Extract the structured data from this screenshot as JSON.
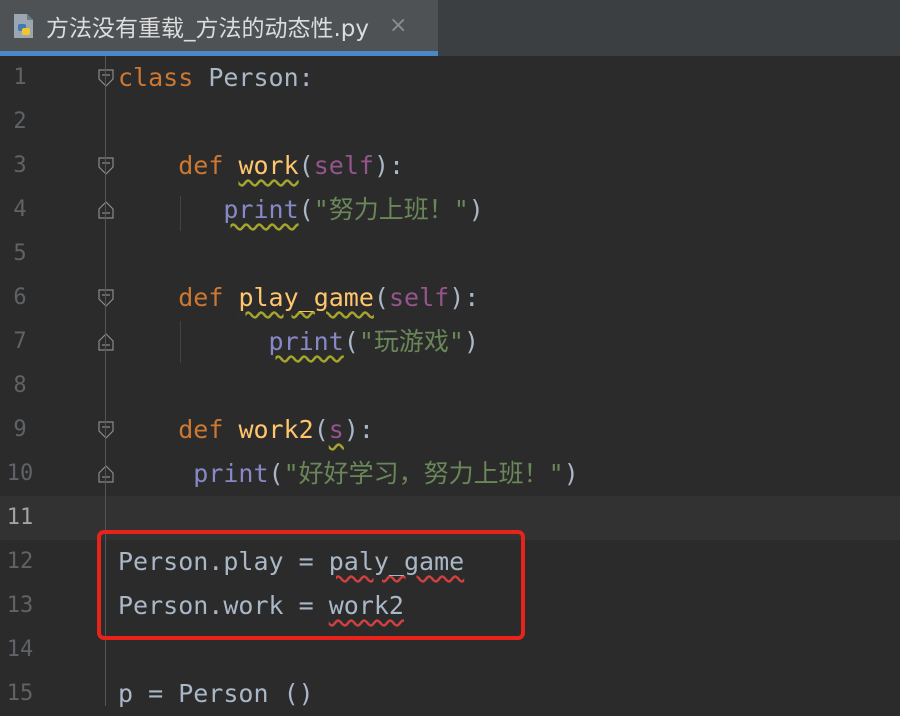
{
  "tab": {
    "title": "方法没有重载_方法的动态性.py",
    "close": "×",
    "icon": "python-file-icon"
  },
  "lines": [
    {
      "n": "1",
      "tokens": [
        [
          "kw",
          "class"
        ],
        [
          "plain",
          " Person:"
        ]
      ]
    },
    {
      "n": "2",
      "tokens": []
    },
    {
      "n": "3",
      "tokens": [
        [
          "plain",
          "    "
        ],
        [
          "kw",
          "def"
        ],
        [
          "plain",
          " "
        ],
        [
          "fn wavy-y",
          "work"
        ],
        [
          "paren",
          "("
        ],
        [
          "self",
          "self"
        ],
        [
          "paren",
          "):"
        ]
      ]
    },
    {
      "n": "4",
      "tokens": [
        [
          "plain",
          "       "
        ],
        [
          "builtin wavy-y",
          "print"
        ],
        [
          "paren",
          "("
        ],
        [
          "str",
          "\"努力上班！\""
        ],
        [
          "paren",
          ")"
        ]
      ]
    },
    {
      "n": "5",
      "tokens": []
    },
    {
      "n": "6",
      "tokens": [
        [
          "plain",
          "    "
        ],
        [
          "kw",
          "def"
        ],
        [
          "plain",
          " "
        ],
        [
          "fn wavy-y",
          "play_game"
        ],
        [
          "paren",
          "("
        ],
        [
          "self",
          "self"
        ],
        [
          "paren",
          "):"
        ]
      ]
    },
    {
      "n": "7",
      "tokens": [
        [
          "plain",
          "          "
        ],
        [
          "builtin wavy-y",
          "print"
        ],
        [
          "paren",
          "("
        ],
        [
          "str",
          "\"玩游戏\""
        ],
        [
          "paren",
          ")"
        ]
      ]
    },
    {
      "n": "8",
      "tokens": []
    },
    {
      "n": "9",
      "tokens": [
        [
          "plain",
          "    "
        ],
        [
          "kw",
          "def"
        ],
        [
          "plain",
          " "
        ],
        [
          "fn",
          "work2"
        ],
        [
          "paren",
          "("
        ],
        [
          "self wavy-y",
          "s"
        ],
        [
          "paren",
          "):"
        ]
      ]
    },
    {
      "n": "10",
      "tokens": [
        [
          "plain",
          "     "
        ],
        [
          "builtin",
          "print"
        ],
        [
          "paren",
          "("
        ],
        [
          "str",
          "\"好好学习，努力上班！\""
        ],
        [
          "paren",
          ")"
        ]
      ]
    },
    {
      "n": "11",
      "tokens": [],
      "current": true
    },
    {
      "n": "12",
      "tokens": [
        [
          "plain",
          "Person.play = "
        ],
        [
          "plain wavy-r",
          "paly_game"
        ]
      ]
    },
    {
      "n": "13",
      "tokens": [
        [
          "plain",
          "Person.work = "
        ],
        [
          "plain wavy-r",
          "work2"
        ]
      ]
    },
    {
      "n": "14",
      "tokens": []
    },
    {
      "n": "15",
      "tokens": [
        [
          "plain",
          "p = Person ()"
        ]
      ]
    }
  ]
}
